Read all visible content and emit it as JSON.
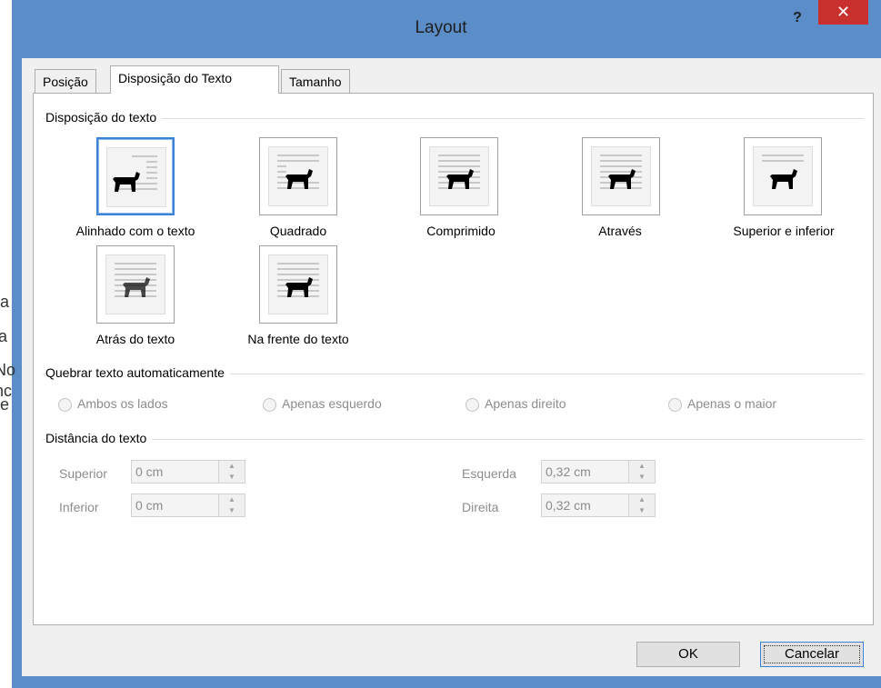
{
  "background": {
    "fragments": [
      "ra",
      "a",
      "No",
      "nc",
      "e"
    ]
  },
  "dialog": {
    "title": "Layout",
    "help_label": "?",
    "close_label": "✕",
    "tabs": [
      {
        "label": "Posição",
        "active": false
      },
      {
        "label": "Disposição do Texto",
        "active": true
      },
      {
        "label": "Tamanho",
        "active": false
      }
    ],
    "wrap_section": {
      "title": "Disposição do texto",
      "options": [
        {
          "label": "Alinhado com o texto",
          "selected": true,
          "icon": "dog-inline-icon"
        },
        {
          "label": "Quadrado",
          "selected": false,
          "icon": "dog-square-icon"
        },
        {
          "label": "Comprimido",
          "selected": false,
          "icon": "dog-tight-icon"
        },
        {
          "label": "Através",
          "selected": false,
          "icon": "dog-through-icon"
        },
        {
          "label": "Superior e inferior",
          "selected": false,
          "icon": "dog-top-bottom-icon"
        },
        {
          "label": "Atrás do texto",
          "selected": false,
          "icon": "dog-behind-icon"
        },
        {
          "label": "Na frente do texto",
          "selected": false,
          "icon": "dog-front-icon"
        }
      ]
    },
    "autowrap_section": {
      "title": "Quebrar texto automaticamente",
      "options": [
        "Ambos os lados",
        "Apenas esquerdo",
        "Apenas direito",
        "Apenas o maior"
      ]
    },
    "distance_section": {
      "title": "Distância do texto",
      "fields": [
        {
          "label": "Superior",
          "value": "0 cm"
        },
        {
          "label": "Inferior",
          "value": "0 cm"
        },
        {
          "label": "Esquerda",
          "value": "0,32 cm"
        },
        {
          "label": "Direita",
          "value": "0,32 cm"
        }
      ]
    },
    "buttons": {
      "ok": "OK",
      "cancel": "Cancelar"
    }
  },
  "colors": {
    "titlebar": "#5b8ec9",
    "close": "#c7302c",
    "selection": "#3c83d8"
  }
}
